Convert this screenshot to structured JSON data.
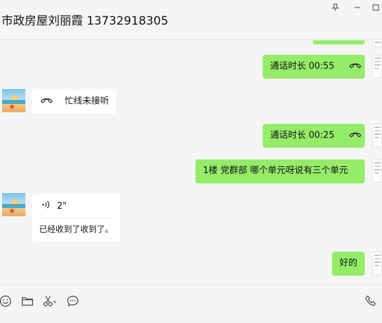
{
  "window": {
    "title": "市政房屋刘丽霞 13732918305",
    "controls": [
      "pin-icon",
      "minimize-icon",
      "maximize-icon"
    ]
  },
  "messages": [
    {
      "from": "me",
      "kind": "call",
      "text": "通话时长 00:55",
      "icon": "phone-hangup-icon"
    },
    {
      "from": "other",
      "kind": "call",
      "text": "忙线未接听",
      "icon": "phone-hangup-icon"
    },
    {
      "from": "me",
      "kind": "call",
      "text": "通话时长 00:25",
      "icon": "phone-hangup-icon"
    },
    {
      "from": "me",
      "kind": "text",
      "text": "1楼 党群部 哪个单元呀说有三个单元"
    },
    {
      "from": "other",
      "kind": "voice",
      "duration": "2\"",
      "transcript": "已经收到了收到了。",
      "icon": "voice-wave-icon"
    },
    {
      "from": "me",
      "kind": "text",
      "text": "好的"
    }
  ],
  "toolbar": {
    "left": [
      "emoji-icon",
      "folder-icon",
      "scissors-icon",
      "chat-bubble-icon"
    ],
    "right": [
      "phone-icon"
    ]
  },
  "colors": {
    "sent_bubble": "#95ec69",
    "received_bubble": "#ffffff",
    "background": "#f5f5f5"
  }
}
